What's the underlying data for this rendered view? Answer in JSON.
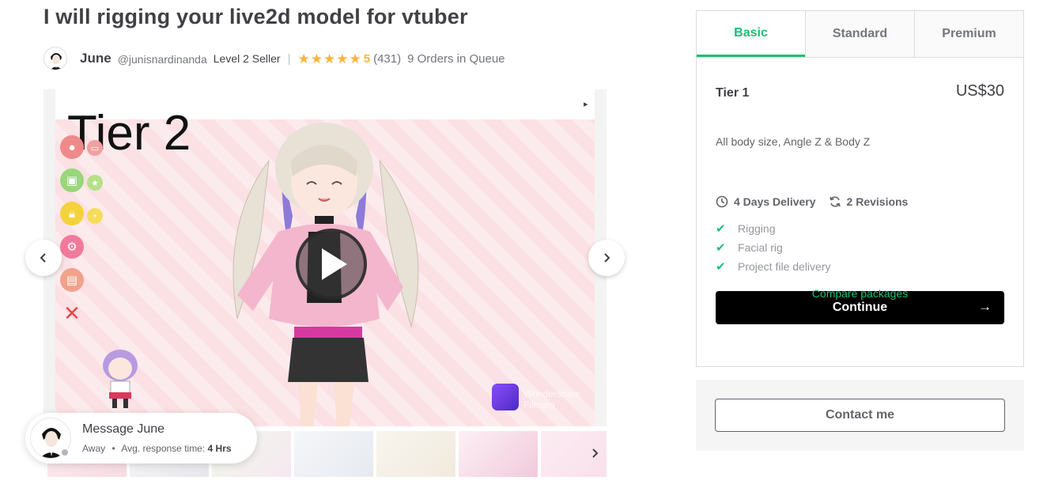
{
  "gig": {
    "title": "I will rigging your live2d model for vtuber"
  },
  "seller": {
    "name": "June",
    "handle": "@junisnardinanda",
    "level": "Level 2 Seller",
    "separator": "|",
    "rating": "5",
    "reviews": "(431)",
    "queue": "9 Orders in Queue",
    "star_count": 5,
    "star_color": "#ffb33e"
  },
  "gallery": {
    "slide_label": "Tier 2",
    "watermark_line1": "Wondershare",
    "watermark_line2": "Filmora",
    "prev_icon": "chevron-left-icon",
    "next_icon": "chevron-right-icon",
    "play_icon": "play-icon",
    "thumbnail_count": 7
  },
  "message": {
    "title": "Message June",
    "status": "Away",
    "dot": "•",
    "response_label": "Avg. response time:",
    "response_value": "4 Hrs"
  },
  "package": {
    "tabs": [
      {
        "label": "Basic",
        "active": true
      },
      {
        "label": "Standard",
        "active": false
      },
      {
        "label": "Premium",
        "active": false
      }
    ],
    "name": "Tier 1",
    "price": "US$30",
    "description": "All body size, Angle Z & Body Z",
    "delivery": "4 Days Delivery",
    "revisions": "2 Revisions",
    "features": [
      "Rigging",
      "Facial rig",
      "Project file delivery"
    ],
    "continue_label": "Continue",
    "compare_label": "Compare packages",
    "accent_color": "#1dbf73"
  },
  "contact": {
    "label": "Contact me"
  }
}
